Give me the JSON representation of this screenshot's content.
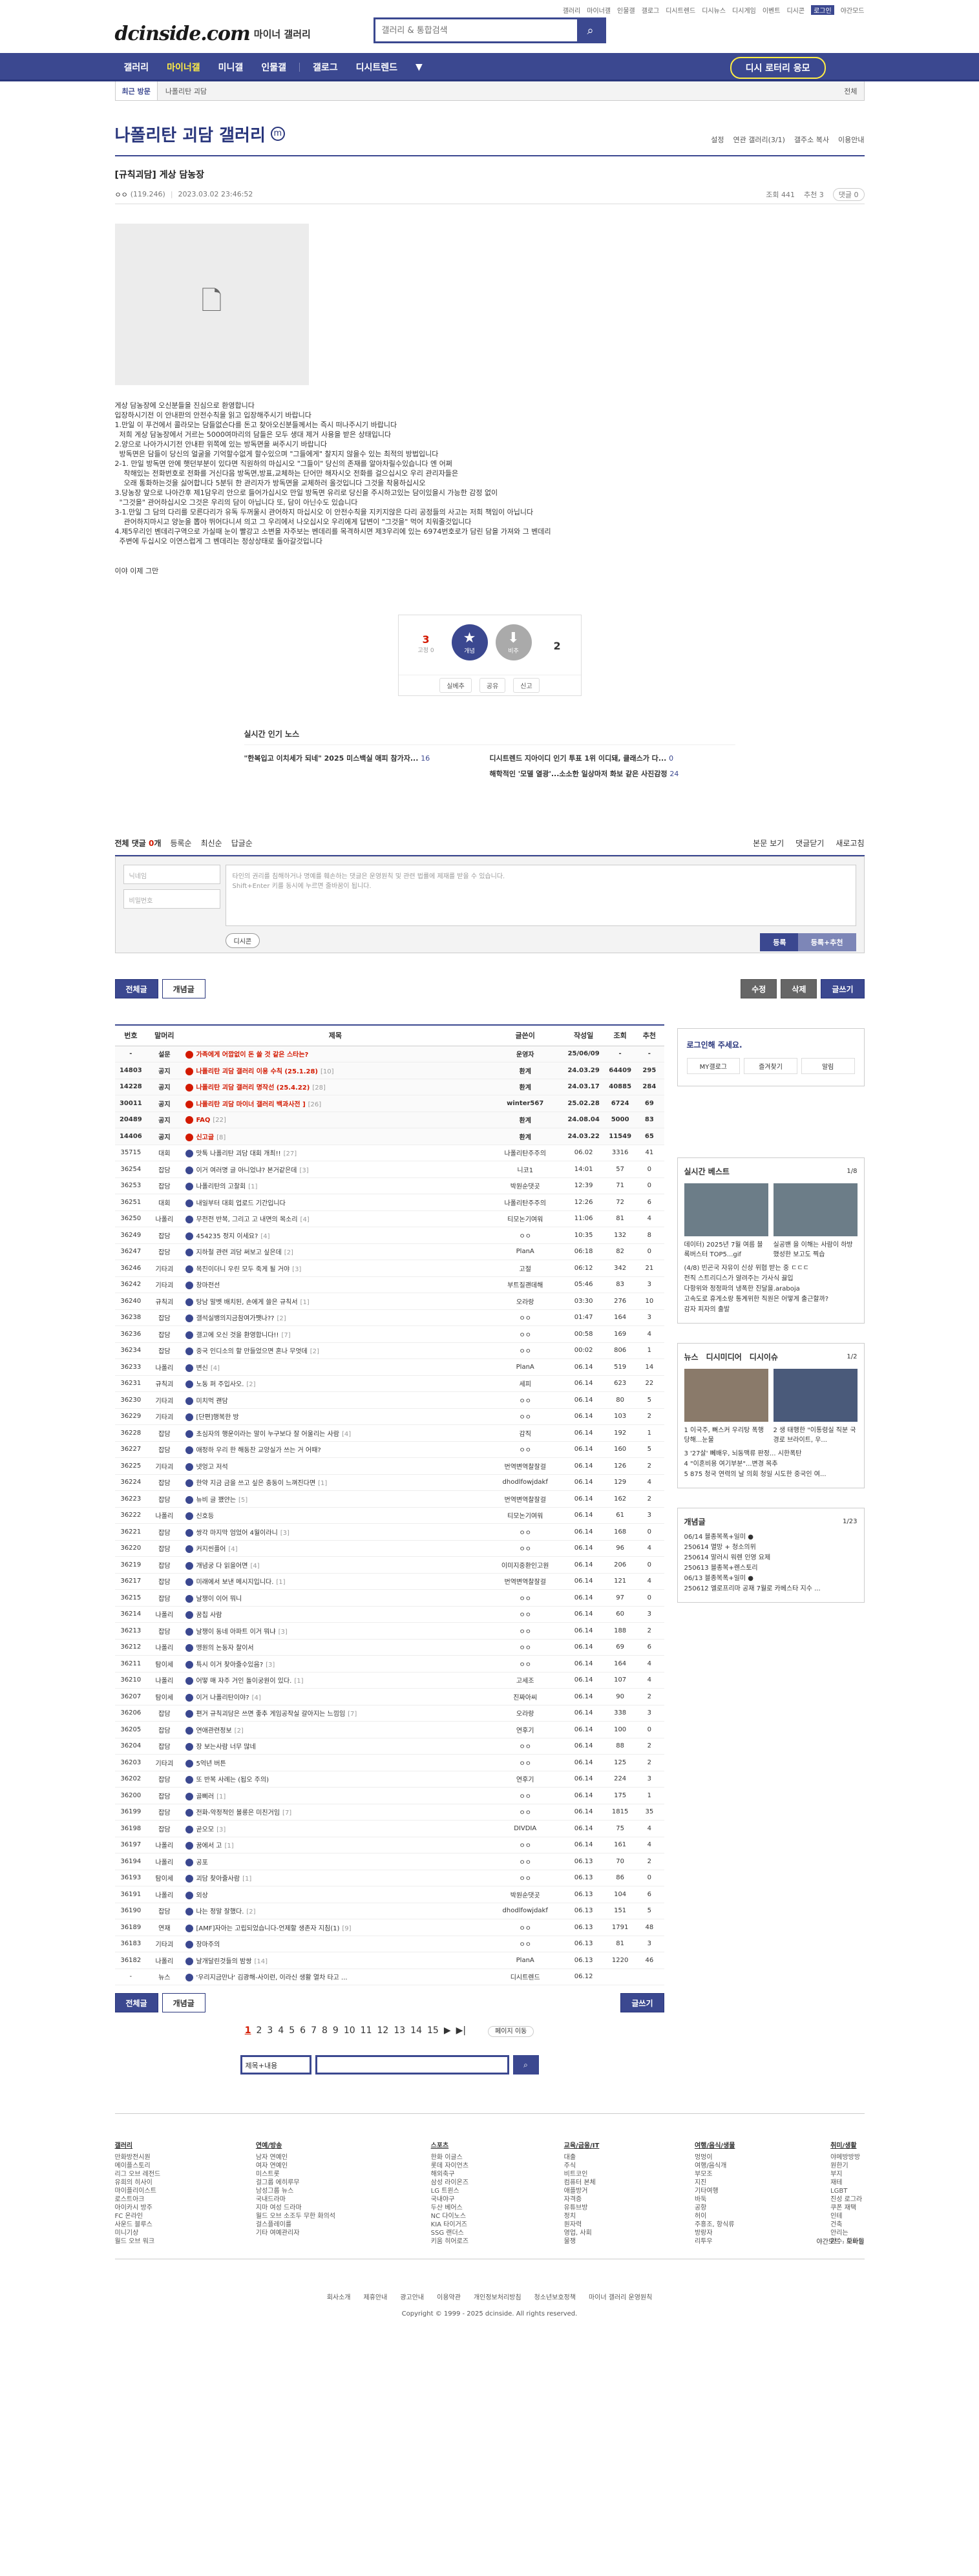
{
  "topbar": {
    "links": [
      "갤러리",
      "마이너갤",
      "인물갤",
      "갤로그",
      "디시트렌드",
      "디시뉴스",
      "디시게임",
      "이벤트",
      "디시콘",
      "로그인",
      "야간모드"
    ]
  },
  "header": {
    "logo": "dcinside.com",
    "logo_sub": "마이너 갤러리",
    "search_placeholder": "갤러리 & 통합검색"
  },
  "gnb": {
    "items": [
      "갤러리",
      "마이너갤",
      "미니갤",
      "인물갤",
      "갤로그",
      "디시트렌드"
    ],
    "recent": "디시 로터리 응모"
  },
  "visit": {
    "label": "최근 방문",
    "item": "나폴리탄 괴담",
    "edit": "전체"
  },
  "gallery": {
    "title": "나폴리탄 괴담 갤러리",
    "mark": "m",
    "tools": [
      "설정",
      "연관 갤러리(3/1)",
      "갤주소 복사",
      "이용안내"
    ]
  },
  "post": {
    "title": "[규칙괴담] 게상 담농장",
    "writer": "ㅇㅇ",
    "ip": "(119.246)",
    "date": "2023.03.02 23:46:52",
    "views": "조회 441",
    "recs": "추천 3",
    "comments": "댓글 0",
    "body": [
      "게상 담농장에 오신분들을 진심으로 환영합니다",
      "입장하시기전 이 안내판의 안전수칙을 읽고 입장해주시기 바랍니다",
      "1.만일 이 푸건에서 콜라모는 담들없슨다를 돈고 찾아오신분들께서는 즉시 떠나주시기 바랍니다",
      "  저희 게상 담농장에서 거르는 5000여마리의 담들은 모두 생대 제거 사용을 받은 상태입니다",
      "2.양으로 나아가시기전 안내판 위쪽에 있는 방독면을 써주시기 바랍니다",
      "  방독면은 담들이 당신의 얼굴을 기억할수없게 할수있으며 \"그들에게\" 찰지지 않을수 있는 최적의 방법입니다",
      "2-1. 만일 방독면 안에 햇던부분이 있다면 직원하의 마십시오 \"그들이\" 당신의 존재를 알아차릴수있습니다 엔 어쩌",
      "    착해있는 전화번호로 전화를 거신다음 방독면,방표,교체하는 단어만 해자시오 전화를 걸으십시오 우리 관리자들은",
      "    오래 통화하는것을 싫어합니다 5분뒤 한 관리자가 방독면을 교체하러 올것입니다 그것을 착용하십시오",
      "3.당농장 앞으로 나아간후 제1담우리 안으로 들어가십시오 만일 방독면 유리로 당신을 주시하고있는 담이있을시 가능한 감정 없이",
      "  \"그것을\" 관어하십시오 그것은 우리의 담이 아닙니다 또, 담이 아닌수도 있습니다",
      "3-1.만일 그 담의 다리를 모른다리가 유독 두꺼울시 관어하지 마십시오 이 안전수칙을 지키지않은 다리 공정들의 사고는 저희 책임이 아닙니다",
      "    관어하지마시고 양눈을 뽑아 뛰어다니셔 의고 그 우리에서 나오십시오 우리에게 답변이 \"그것을\" 먹어 치워줄것입니다",
      "4.제5우리인 벤데리구역으로 가실때 눈이 빨강고 소변을 자주보는 벤데리를 목격하시면 제3우리에 있는 6974번호로가 담린 담을 가져와 그 벤데리",
      "  주변에 두십시오 이연스럽게 그 벤데리는 정상상태로 돌아갈것입니다"
    ],
    "tail": "이야 이제 그만",
    "upvotes": "3",
    "fix_votes": "0",
    "downvotes": "2",
    "vote_up_label": "개념",
    "vote_down_label": "비추",
    "vote_bottom": [
      "실베추",
      "공유",
      "신고"
    ]
  },
  "popular": {
    "title": "실시간 인기 노스",
    "rows": [
      {
        "t": "\"한복입고 이치세가 되네\" 2025 미스백실 애피 참가자...",
        "c": "16"
      },
      {
        "t": "디시트렌드 지아이디 인기 투표 1위 이디돼, 클래스가 다...",
        "c": "0"
      },
      {
        "t": "",
        "c": ""
      },
      {
        "t": "해학적인 '모델 열광'...소소한 일상마저 화보 같은 사진감정",
        "c": "24"
      }
    ]
  },
  "comments": {
    "label": "전체 댓글",
    "count": "0",
    "unit": "개",
    "opts": [
      "등록순",
      "최신순",
      "답글순"
    ],
    "right": [
      "본문 보기",
      "댓글닫기",
      "새로고침"
    ],
    "name_ph": "닉네임",
    "pw_ph": "비밀번호",
    "text_ph": "타인의 권리를 침해하거나 명예를 훼손하는 댓글은 운영원칙 및 관련 법률에 제재를 받을 수 있습니다.",
    "text_ph2": "Shift+Enter 키를 동시에 누르면 줄바꿈이 됩니다.",
    "dccon": "디시콘",
    "submit": "등록",
    "submit2": "등록+추천"
  },
  "buttons": {
    "all": "전체글",
    "concept": "개념글",
    "edit": "수정",
    "delete": "삭제",
    "write": "글쓰기"
  },
  "table": {
    "headers": [
      "번호",
      "말머리",
      "제목",
      "글쓴이",
      "작성일",
      "조회",
      "추천"
    ],
    "rows": [
      [
        "-",
        "설문",
        "가족에게 어깝없이 돈 쓸 것 같은 스타는?",
        "",
        "운영자",
        "25/06/09",
        "-",
        "-",
        "n"
      ],
      [
        "14803",
        "공지",
        "나폴리탄 괴담 갤러리 이용 수칙 (25.1.28)",
        "[10]",
        "환계",
        "24.03.29",
        "64409",
        "295",
        "n"
      ],
      [
        "14228",
        "공지",
        "나폴리탄 괴담 갤러리 명작선 (25.4.22)",
        "[28]",
        "환계",
        "24.03.17",
        "40885",
        "284",
        "n"
      ],
      [
        "30011",
        "공지",
        "나폴리탄 괴담 마이너 갤러리 백과사전 ]",
        "[26]",
        "winter567",
        "25.02.28",
        "6724",
        "69",
        "n"
      ],
      [
        "20489",
        "공지",
        "FAQ",
        "[22]",
        "환계",
        "24.08.04",
        "5000",
        "83",
        "n"
      ],
      [
        "14406",
        "공지",
        "신고글",
        "[8]",
        "환계",
        "24.03.22",
        "11549",
        "65",
        "n"
      ],
      [
        "35715",
        "대회",
        "맛톡 나폴리탄 괴담 대회 개최!!",
        "[27]",
        "나폴리탄주주의",
        "06.02",
        "3316",
        "41",
        ""
      ],
      [
        "36254",
        "잡담",
        "이거 여러명 글 아니었냐? 본거같은데",
        "[3]",
        "니코1",
        "14:01",
        "57",
        "0",
        ""
      ],
      [
        "36253",
        "잡담",
        "나폴리탄의 고찰회",
        "[1]",
        "박원순댓곳",
        "12:39",
        "71",
        "0",
        ""
      ],
      [
        "36251",
        "대회",
        "내일부터 대회 업로드 기간입니다",
        "",
        "나폴리탄주주의",
        "12:26",
        "72",
        "6",
        ""
      ],
      [
        "36250",
        "나폴리",
        "무전전 반복, 그리고 고 내면의 목소리",
        "[4]",
        "티모논기여워",
        "11:06",
        "81",
        "4",
        ""
      ],
      [
        "36249",
        "잡담",
        "454235 정지 이세요?",
        "[4]",
        "ㅇㅇ",
        "10:35",
        "132",
        "8",
        ""
      ],
      [
        "36247",
        "잡담",
        "지하철 관련 괴담 써보고 싶은데",
        "[2]",
        "PlanA",
        "06:18",
        "82",
        "0",
        ""
      ],
      [
        "36246",
        "기타괴",
        "목진이더니 우린 모두 죽게 될 거야",
        "[3]",
        "고절",
        "06:12",
        "342",
        "21",
        ""
      ],
      [
        "36242",
        "기타괴",
        "창마전선",
        "",
        "부트질괜데해",
        "05:46",
        "83",
        "3",
        ""
      ],
      [
        "36240",
        "규칙괴",
        "탕남 말벳 배치된, 손에게 쓸은 규칙서",
        "[1]",
        "오라랑",
        "03:30",
        "276",
        "10",
        ""
      ],
      [
        "36238",
        "잡담",
        "갤석실뱅의지금참여가쨋나??",
        "[2]",
        "ㅇㅇ",
        "01:47",
        "164",
        "3",
        ""
      ],
      [
        "36236",
        "잡담",
        "갤고에 오신 것을 환영합니다!!",
        "[7]",
        "ㅇㅇ",
        "00:58",
        "169",
        "4",
        ""
      ],
      [
        "36234",
        "잡담",
        "중국 인디소의 할 만들었으면 혼나 무엇데",
        "[2]",
        "ㅇㅇ",
        "00:02",
        "806",
        "1",
        ""
      ],
      [
        "36233",
        "나폴리",
        "변신",
        "[4]",
        "PlanA",
        "06.14",
        "519",
        "14",
        ""
      ],
      [
        "36231",
        "규칙괴",
        "노동 퍼 주입사오.",
        "[2]",
        "세피",
        "06.14",
        "623",
        "22",
        ""
      ],
      [
        "36230",
        "기타괴",
        "미치먹 괜담",
        "",
        "ㅇㅇ",
        "06.14",
        "80",
        "5",
        ""
      ],
      [
        "36229",
        "기타괴",
        "[단편]행복한 방",
        "",
        "ㅇㅇ",
        "06.14",
        "103",
        "2",
        ""
      ],
      [
        "36228",
        "잡담",
        "초심자의 행운이라는 말이 누구보다 잘 어울리는 사람",
        "[4]",
        "감직",
        "06.14",
        "192",
        "1",
        ""
      ],
      [
        "36227",
        "잡담",
        "애정하 우리 한 해동찬 교양실가 쓰는 거 어때?",
        "",
        "ㅇㅇ",
        "06.14",
        "160",
        "5",
        ""
      ],
      [
        "36225",
        "기타괴",
        "넷엉고 저석",
        "",
        "번역변역찰잘걸",
        "06.14",
        "126",
        "2",
        ""
      ],
      [
        "36224",
        "잡담",
        "한약 지금 금을 쓰고 싶은 충동이 느껴진다면",
        "[1]",
        "dhodlfowjdakf",
        "06.14",
        "129",
        "4",
        ""
      ],
      [
        "36223",
        "잡담",
        "뉴비 글 꽸얀는",
        "[5]",
        "번역변역찰잘걸",
        "06.14",
        "162",
        "2",
        ""
      ],
      [
        "36222",
        "나폴리",
        "신호등",
        "",
        "티모논기여워",
        "06.14",
        "61",
        "3",
        ""
      ],
      [
        "36221",
        "잡담",
        "쌍각 마지막 엄었어 4월이라니",
        "[3]",
        "ㅇㅇ",
        "06.14",
        "168",
        "0",
        ""
      ],
      [
        "36220",
        "잡담",
        "커지씬플어",
        "[4]",
        "ㅇㅇ",
        "06.14",
        "96",
        "4",
        ""
      ],
      [
        "36219",
        "잡담",
        "개념궁 다 읽을어면",
        "[4]",
        "이미지중환인고원",
        "06.14",
        "206",
        "0",
        ""
      ],
      [
        "36217",
        "잡담",
        "미래에서 보낸 메시지입니다.",
        "[1]",
        "번역변역찰잘걸",
        "06.14",
        "121",
        "4",
        ""
      ],
      [
        "36215",
        "잡담",
        "날쟁이 이어 뭐니",
        "",
        "ㅇㅇ",
        "06.14",
        "97",
        "0",
        ""
      ],
      [
        "36214",
        "나폴리",
        "꿈칩 사람",
        "",
        "ㅇㅇ",
        "06.14",
        "60",
        "3",
        ""
      ],
      [
        "36213",
        "잡담",
        "날쟁이 동네 아파트 이거 뭐냐",
        "[3]",
        "ㅇㅇ",
        "06.14",
        "188",
        "2",
        ""
      ],
      [
        "36212",
        "나폴리",
        "맹원의 논동자 찰이서",
        "",
        "ㅇㅇ",
        "06.14",
        "69",
        "6",
        ""
      ],
      [
        "36211",
        "탐이세",
        "특시 이거 찾아줄수있음?",
        "[3]",
        "ㅇㅇ",
        "06.14",
        "164",
        "4",
        ""
      ],
      [
        "36210",
        "나폴리",
        "어떻 매 자주 거인 돌이궁원이 있다.",
        "[1]",
        "고세조",
        "06.14",
        "107",
        "4",
        ""
      ],
      [
        "36207",
        "탐이세",
        "이거 나폴리탄이야?",
        "[4]",
        "진짜아씨",
        "06.14",
        "90",
        "2",
        ""
      ],
      [
        "36206",
        "잡담",
        "편거 규칙괴담은 쓰면 좋추 게임공작실 갈아지는 느낌임",
        "[7]",
        "오라랑",
        "06.14",
        "338",
        "3",
        ""
      ],
      [
        "36205",
        "잡담",
        "연애관련정보",
        "[2]",
        "연후기",
        "06.14",
        "100",
        "0",
        ""
      ],
      [
        "36204",
        "잡담",
        "장 보는사람 너무 많네",
        "",
        "ㅇㅇ",
        "06.14",
        "88",
        "2",
        ""
      ],
      [
        "36203",
        "기타괴",
        "5억년 버튼",
        "",
        "ㅇㅇ",
        "06.14",
        "125",
        "2",
        ""
      ],
      [
        "36202",
        "잡담",
        "또 반복 사례는 (됩오 주의)",
        "",
        "연후기",
        "06.14",
        "224",
        "3",
        ""
      ],
      [
        "36200",
        "잡담",
        "골삐러",
        "[1]",
        "ㅇㅇ",
        "06.14",
        "175",
        "1",
        ""
      ],
      [
        "36199",
        "잡담",
        "전화-악정적인 볼롱은 미친거임",
        "[7]",
        "ㅇㅇ",
        "06.14",
        "1815",
        "35",
        ""
      ],
      [
        "36198",
        "잡담",
        "곧오모",
        "[3]",
        "DIVDIA",
        "06.14",
        "75",
        "4",
        ""
      ],
      [
        "36197",
        "나폴리",
        "꿈에서 고",
        "[1]",
        "ㅇㅇ",
        "06.14",
        "161",
        "4",
        ""
      ],
      [
        "36194",
        "나폴리",
        "공포",
        "",
        "ㅇㅇ",
        "06.13",
        "70",
        "2",
        ""
      ],
      [
        "36193",
        "탐이세",
        "괴담 찾아줄사람",
        "[1]",
        "ㅇㅇ",
        "06.13",
        "86",
        "0",
        ""
      ],
      [
        "36191",
        "나폴리",
        "외상",
        "",
        "박원순댓곳",
        "06.13",
        "104",
        "6",
        ""
      ],
      [
        "36190",
        "잡담",
        "나는 정말 잘했다.",
        "[2]",
        "dhodlfowjdakf",
        "06.13",
        "151",
        "5",
        ""
      ],
      [
        "36189",
        "연재",
        "[AMF]자아는 고립되었습니다-언제할 생존자 지침(1)",
        "[9]",
        "ㅇㅇ",
        "06.13",
        "1791",
        "48",
        ""
      ],
      [
        "36183",
        "기타괴",
        "장마주의",
        "",
        "ㅇㅇ",
        "06.13",
        "81",
        "3",
        ""
      ],
      [
        "36182",
        "나폴리",
        "날개달린것들의 밤쌍",
        "[14]",
        "PlanA",
        "06.13",
        "1220",
        "46",
        ""
      ],
      [
        "-",
        "뉴스",
        "'우리지금만나' 김광해-사이런, 이라신 생활 열차 타고 ...",
        "",
        "디시트렌드",
        "06.12",
        "",
        "",
        ""
      ]
    ]
  },
  "side": {
    "login": "로그인해 주세요.",
    "login_links": [
      "MY갤로그",
      "즐겨찾기",
      "알림"
    ],
    "best": "실시간 베스트",
    "best_pg": "1/8",
    "best_caps": [
      "데이터) 2025년 7월 여름 블록버스터 TOP5...gif",
      "실공밴 을 이해는 사람이 하방 했성한 보고도 찍습"
    ],
    "best_list": [
      "(4/8) 빈곤국 자유이 신상 위협 받는 중 ㄷㄷㄷ",
      "전직 스트리디스가 알려주는 가사식 끓입",
      "다항위와 정정파의 냉폭한 진달을.araboja",
      "고속도로 휴게소랑 통계위한 직원은 어떻게 출근할까?",
      "감자 피자의 출발"
    ],
    "news": [
      "뉴스",
      "디시미디어",
      "디시이슈"
    ],
    "news_pg": "1/2",
    "news_caps": [
      "1 이국주, 뻐스커 우리탕 폭행 당해...눈물",
      "2 생 태행한 \"이통령실 직분 국경로 브라이트, 우..."
    ],
    "news_list": [
      "3 '27살' 뻬배우, 뇌동맥류 판정... 시한폭탄",
      "4 \"이혼비용 여기부분\"...변경 목추",
      "5 875 청국 연력의 날 의회 청일 시도한 중국인 여..."
    ],
    "concept": "개념글",
    "concept_pg": "1/23",
    "concept_list": [
      "06/14 블종복폭+일미 ●",
      "250614 멸망 + 청소의위",
      "250614 말러시 워렌 인영 요제",
      "250613 블종복+렌스토리",
      "06/13 블종복폭+일미 ●",
      "250612 엘로프리마 공재 7월로 카베스타 지수 ..."
    ]
  },
  "paging": {
    "pages": [
      "1",
      "2",
      "3",
      "4",
      "5",
      "6",
      "7",
      "8",
      "9",
      "10",
      "11",
      "12",
      "13",
      "14",
      "15"
    ],
    "next": "▶",
    "last": "▶|",
    "jump": "페이지 이동"
  },
  "bsearch": {
    "select": "제목+내용"
  },
  "sitemap": [
    {
      "h": "갤러리",
      "items": [
        "만화방전시원",
        "메이플스토리",
        "리그 오브 레전드",
        "유희의 히사이",
        "마이플리이스트",
        "로스트아크",
        "아이카시 방주",
        "FC 온라인",
        "사운드 블루스",
        "미니기상",
        "월드 오브 워크"
      ]
    },
    {
      "h": "연예/방송",
      "items": [
        "남자 연예인",
        "여자 연예인",
        "미스트롯",
        "걸그룹 에히루무",
        "남성그룹 뉴스",
        "국내드라마",
        "지마 여성 드라마",
        "월드 오브 소조두 무한 화의석",
        "걸스플레이를",
        "기타 여예관리자"
      ]
    },
    {
      "h": "스포츠",
      "items": [
        "한화 이글스",
        "롯데 자이언츠",
        "해외축구",
        "삼성 라이온즈",
        "LG 트윈스",
        "국내야구",
        "두산 베어스",
        "NC 다이노스",
        "KIA 타이거즈",
        "SSG 랜더스",
        "키움 히어로즈"
      ]
    },
    {
      "h": "교육/금융/IT",
      "items": [
        "대출",
        "주식",
        "비트코인",
        "컴퓨터 본체",
        "애플방거",
        "자격증",
        "유튜브방",
        "정치",
        "원자력",
        "영업, 사회",
        "물쟁"
      ]
    },
    {
      "h": "여행/음식/생물",
      "items": [
        "멍멍이",
        "여행/음식개",
        "부모조",
        "지진",
        "기타여행",
        "바둑",
        "공항",
        "허이",
        "주흥조, 항식류",
        "방랑자",
        "리투우"
      ]
    },
    {
      "h": "취미/생활",
      "items": [
        "야메방방방",
        "원한기",
        "부지",
        "재테",
        "LGBT",
        "진성 로그라",
        "쿠폰 재택",
        "인테",
        "건축",
        "안리는",
        "양수, 화화둠"
      ]
    }
  ],
  "foot": {
    "night": "야간모드",
    "mobile": "모바일",
    "links": [
      "회사소개",
      "제휴안내",
      "광고안내",
      "이용약관",
      "개인정보처리방침",
      "청소년보호정책",
      "마이너 갤러리 운영원칙"
    ],
    "copy": "Copyright © 1999 - 2025 dcinside. All rights reserved."
  }
}
